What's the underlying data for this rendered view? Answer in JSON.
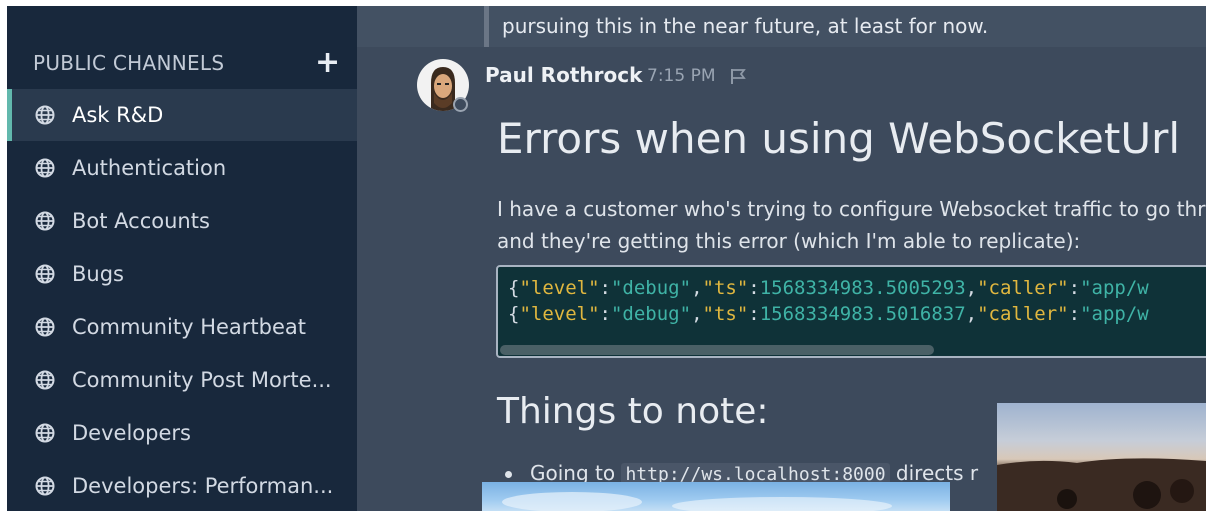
{
  "sidebar": {
    "section_title": "PUBLIC CHANNELS",
    "add_label": "+",
    "channels": [
      {
        "label": "Ask R&D",
        "active": true
      },
      {
        "label": "Authentication"
      },
      {
        "label": "Bot Accounts"
      },
      {
        "label": "Bugs"
      },
      {
        "label": "Community Heartbeat"
      },
      {
        "label": "Community Post Morte..."
      },
      {
        "label": "Developers"
      },
      {
        "label": "Developers: Performan..."
      }
    ],
    "icon": "globe-icon"
  },
  "colors": {
    "sidebar_bg": "#18283c",
    "active_indicator": "#62b8ad",
    "main_bg": "#3d4a5c",
    "code_bg": "#0f3238",
    "json_key": "#e0b73f",
    "json_value": "#3fb3a6"
  },
  "previous_message": {
    "text": "pursuing this in the near future, at least for now."
  },
  "post": {
    "author": "Paul Rothrock",
    "time": "7:15 PM",
    "avatar_icon": "avatar-icon",
    "flag_icon": "flag-icon",
    "heading": "Errors when using WebSocketUrl",
    "paragraph_line1": "I have a customer who's trying to configure Websocket traffic to go thro",
    "paragraph_line2": "and they're getting this error (which I'm able to replicate):",
    "code_lines": [
      {
        "k1": "\"level\"",
        "v1": "\"debug\"",
        "k2": "\"ts\"",
        "v2": "1568334983.5005293",
        "k3": "\"caller\"",
        "v3": "\"app/w"
      },
      {
        "k1": "\"level\"",
        "v1": "\"debug\"",
        "k2": "\"ts\"",
        "v2": "1568334983.5016837",
        "k3": "\"caller\"",
        "v3": "\"app/w"
      }
    ],
    "code_punct": {
      "open": "{",
      "colon": ":",
      "comma": ","
    },
    "subheading": "Things to note:",
    "bullet_prefix": "Going to",
    "bullet_code": "http://ws.localhost:8000",
    "bullet_suffix": "directs r"
  }
}
